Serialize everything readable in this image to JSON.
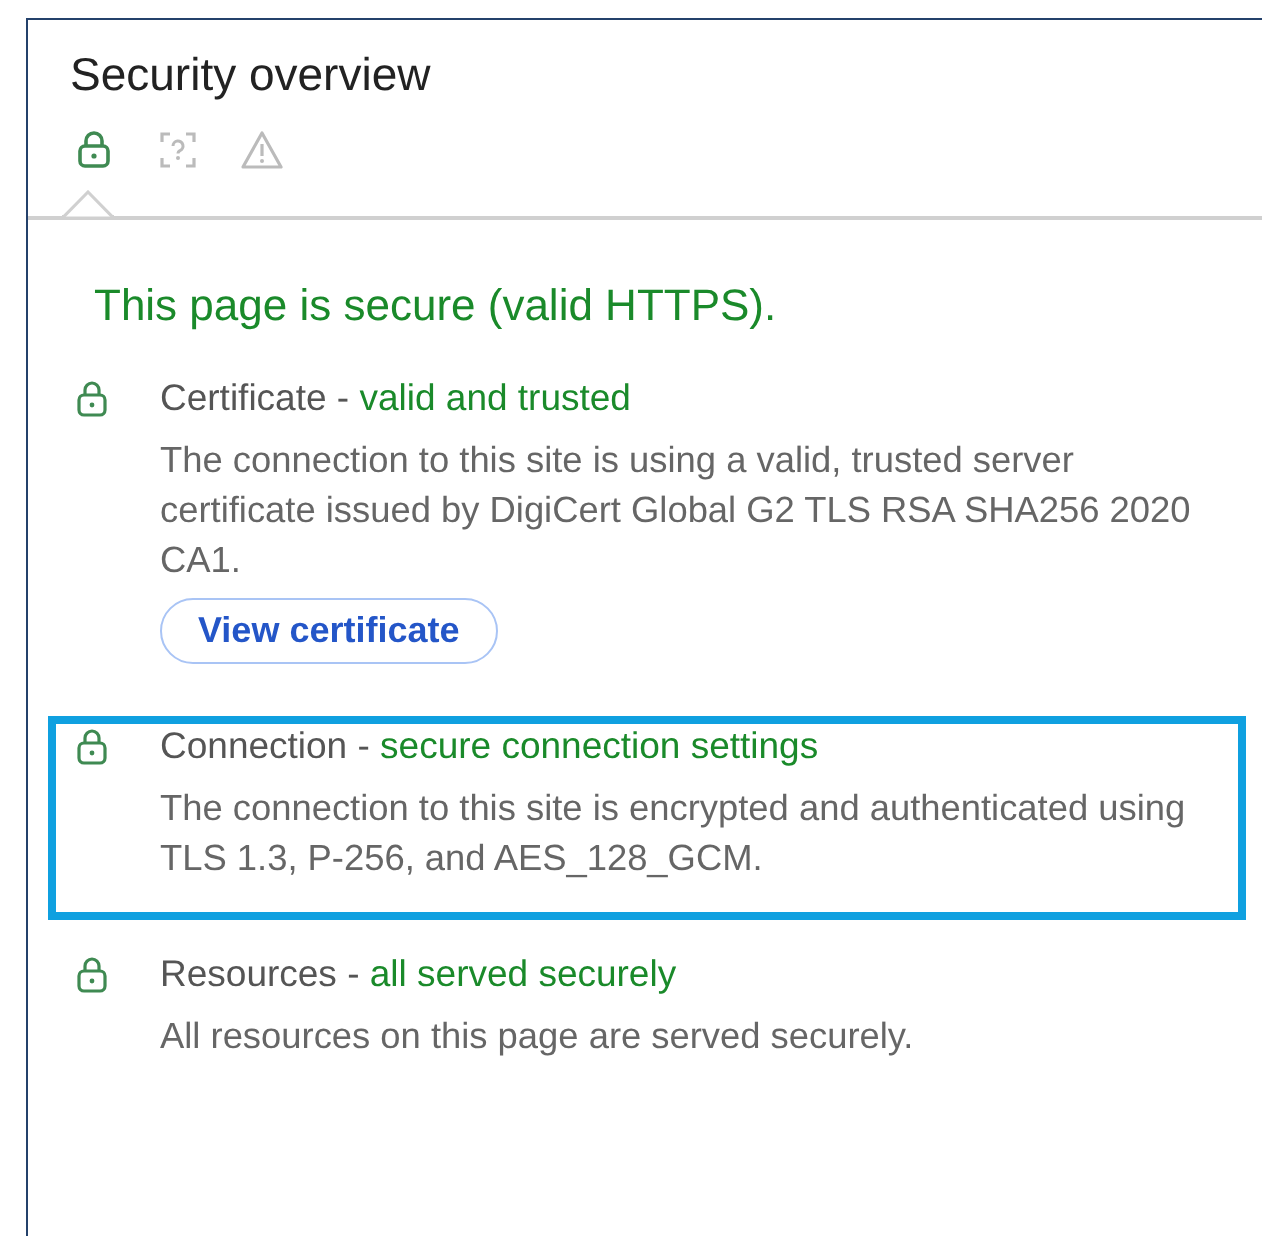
{
  "panel": {
    "title": "Security overview"
  },
  "tabs": [
    {
      "kind": "lock",
      "selected": true
    },
    {
      "kind": "unknown",
      "selected": false
    },
    {
      "kind": "warning",
      "selected": false
    }
  ],
  "summary": "This page is secure (valid HTTPS).",
  "sections": [
    {
      "name": "Certificate",
      "separator": " - ",
      "status": "valid and trusted",
      "description": "The connection to this site is using a valid, trusted server certificate issued by DigiCert Global G2 TLS RSA SHA256 2020 CA1.",
      "button": "View certificate",
      "highlighted": false
    },
    {
      "name": "Connection",
      "separator": " - ",
      "status": "secure connection settings",
      "description": "The connection to this site is encrypted and authenticated using TLS 1.3, P-256, and AES_128_GCM.",
      "highlighted": true
    },
    {
      "name": "Resources",
      "separator": " - ",
      "status": "all served securely",
      "description": "All resources on this page are served securely.",
      "highlighted": false
    }
  ]
}
